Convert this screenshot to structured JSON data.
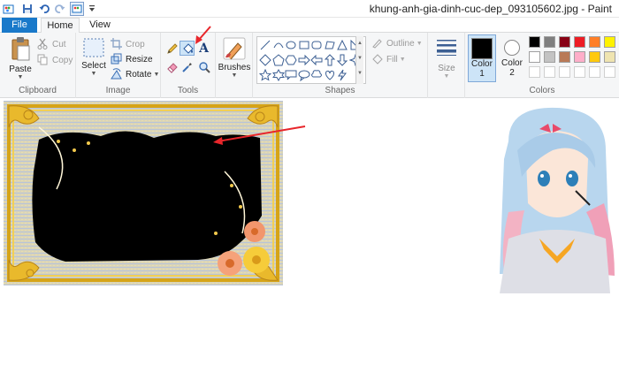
{
  "window": {
    "title": "khung-anh-gia-dinh-cuc-dep_093105602.jpg - Paint"
  },
  "quick_access": [
    {
      "icon": "paint-app-icon"
    },
    {
      "icon": "save-icon"
    },
    {
      "icon": "undo-icon"
    },
    {
      "icon": "redo-icon"
    },
    {
      "icon": "paint-app-small-icon"
    },
    {
      "icon": "customize-dropdown-icon"
    }
  ],
  "tabs": {
    "file": "File",
    "home": "Home",
    "view": "View"
  },
  "ribbon": {
    "clipboard": {
      "label": "Clipboard",
      "paste": "Paste",
      "cut": "Cut",
      "copy": "Copy"
    },
    "image": {
      "label": "Image",
      "select": "Select",
      "crop": "Crop",
      "resize": "Resize",
      "rotate": "Rotate"
    },
    "tools": {
      "label": "Tools",
      "text_glyph": "A"
    },
    "brushes": {
      "label": "Brushes"
    },
    "shapes": {
      "label": "Shapes",
      "outline": "Outline",
      "fill": "Fill"
    },
    "size": {
      "label": "Size"
    },
    "colors": {
      "label": "Colors",
      "color1_label": "Color",
      "color1_num": "1",
      "color2_label": "Color",
      "color2_num": "2",
      "color1": "#000000",
      "color2": "#ffffff",
      "palette": [
        "#000000",
        "#7f7f7f",
        "#880015",
        "#ed1c24",
        "#ff7f27",
        "#fff200",
        "#ffffff",
        "#c3c3c3",
        "#b97a57",
        "#ffaec9",
        "#ffc90e",
        "#efe4b0"
      ]
    }
  },
  "annotations": {
    "arrow_color": "#e8262b"
  }
}
